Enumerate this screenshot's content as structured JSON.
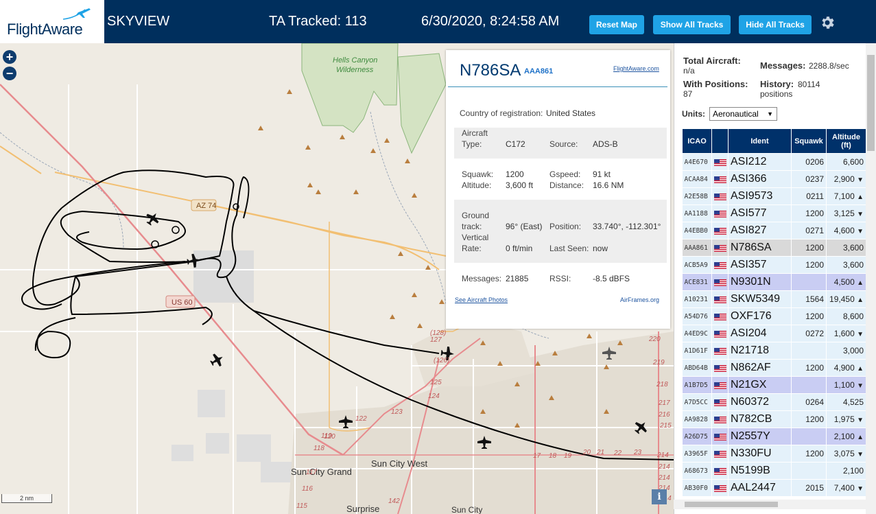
{
  "header": {
    "logo": "FlightAware",
    "site_name": "SKYVIEW",
    "tracked": "TA Tracked: 113",
    "datetime": "6/30/2020, 8:24:58 AM",
    "reset_map": "Reset Map",
    "show_all_tracks": "Show All Tracks",
    "hide_all_tracks": "Hide All Tracks",
    "settings_icon": "gear-icon"
  },
  "map": {
    "zoom_in": "+",
    "zoom_out": "−",
    "scale": "2 nm",
    "info": "i",
    "labels": {
      "wilderness1": "Hells Canyon",
      "wilderness2": "Wilderness",
      "route_az74": "AZ 74",
      "route_us60": "US 60",
      "city1": "Sun City Grand",
      "city2": "Sun City West",
      "city3": "Surprise",
      "city4": "Sun City",
      "r128": "(128)",
      "r127": "127",
      "r126": "(126)",
      "r125": "125",
      "r124": "124",
      "r123": "123",
      "r122": "122",
      "r121": "121",
      "r120": "120",
      "r119": "119",
      "r118": "118",
      "r117": "117",
      "r116": "116",
      "r115": "115",
      "r142": "142",
      "r17": "17",
      "r18": "18",
      "r19": "19",
      "r20": "20",
      "r21": "21",
      "r22": "22",
      "r23": "23",
      "r220": "220",
      "r219": "219",
      "r218": "218",
      "r217": "217",
      "r216": "216",
      "r215": "215",
      "r214a": "214",
      "r214b": "214",
      "r214c": "214",
      "r214d": "214",
      "r214e": "214"
    }
  },
  "popup": {
    "callsign": "N786SA",
    "icao": "AAA861",
    "flightaware_link": "FlightAware.com",
    "country_label": "Country of registration:",
    "country_value": "United States",
    "aircraft_type_label1": "Aircraft",
    "aircraft_type_label2": "Type:",
    "aircraft_type": "C172",
    "source_label": "Source:",
    "source": "ADS-B",
    "squawk_label": "Squawk:",
    "squawk": "1200",
    "gspeed_label": "Gspeed:",
    "gspeed": "91 kt",
    "altitude_label": "Altitude:",
    "altitude": "3,600 ft",
    "distance_label": "Distance:",
    "distance": "16.6 NM",
    "gt_label1": "Ground",
    "gt_label2": "track:",
    "ground_track": "96° (East)",
    "position_label": "Position:",
    "position": "33.740°, -112.301°",
    "vr_label1": "Vertical",
    "vr_label2": "Rate:",
    "vertical_rate": "0 ft/min",
    "last_seen_label": "Last Seen:",
    "last_seen": "now",
    "messages_label": "Messages:",
    "messages": "21885",
    "rssi_label": "RSSI:",
    "rssi": "-8.5 dBFS",
    "photos_link": "See Aircraft Photos",
    "airframes": "AirFrames.org"
  },
  "panel": {
    "total_aircraft_label": "Total Aircraft:",
    "total_aircraft": "n/a",
    "messages_label": "Messages:",
    "messages": "2288.8/sec",
    "with_positions_label": "With Positions:",
    "with_positions": "87",
    "history_label": "History:",
    "history_value": "80114",
    "history_unit": "positions",
    "units_label": "Units:",
    "units_value": "Aeronautical",
    "columns": [
      "ICAO",
      "",
      "Ident",
      "Squawk",
      "Altitude",
      "(ft)"
    ],
    "rows": [
      {
        "icao": "A4E670",
        "ident": "ASI212",
        "squawk": "0206",
        "alt": "6,600",
        "trend": "",
        "style": ""
      },
      {
        "icao": "ACAA84",
        "ident": "ASI366",
        "squawk": "0237",
        "alt": "2,900",
        "trend": "▼",
        "style": ""
      },
      {
        "icao": "A2E58B",
        "ident": "ASI9573",
        "squawk": "0211",
        "alt": "7,100",
        "trend": "▲",
        "style": ""
      },
      {
        "icao": "AA1188",
        "ident": "ASI577",
        "squawk": "1200",
        "alt": "3,125",
        "trend": "▼",
        "style": ""
      },
      {
        "icao": "A4EBB0",
        "ident": "ASI827",
        "squawk": "0271",
        "alt": "4,600",
        "trend": "▼",
        "style": ""
      },
      {
        "icao": "AAA861",
        "ident": "N786SA",
        "squawk": "1200",
        "alt": "3,600",
        "trend": "",
        "style": "sel"
      },
      {
        "icao": "ACB5A9",
        "ident": "ASI357",
        "squawk": "1200",
        "alt": "3,600",
        "trend": "",
        "style": ""
      },
      {
        "icao": "ACE831",
        "ident": "N9301N",
        "squawk": "",
        "alt": "4,500",
        "trend": "▲",
        "style": "mlat"
      },
      {
        "icao": "A10231",
        "ident": "SKW5349",
        "squawk": "1564",
        "alt": "19,450",
        "trend": "▲",
        "style": ""
      },
      {
        "icao": "A54D76",
        "ident": "OXF176",
        "squawk": "1200",
        "alt": "8,600",
        "trend": "",
        "style": ""
      },
      {
        "icao": "A4ED9C",
        "ident": "ASI204",
        "squawk": "0272",
        "alt": "1,600",
        "trend": "▼",
        "style": ""
      },
      {
        "icao": "A1D61F",
        "ident": "N21718",
        "squawk": "",
        "alt": "3,000",
        "trend": "",
        "style": ""
      },
      {
        "icao": "ABD64B",
        "ident": "N862AF",
        "squawk": "1200",
        "alt": "4,900",
        "trend": "▲",
        "style": ""
      },
      {
        "icao": "A1B7D5",
        "ident": "N21GX",
        "squawk": "",
        "alt": "1,100",
        "trend": "▼",
        "style": "mlat"
      },
      {
        "icao": "A7D5CC",
        "ident": "N60372",
        "squawk": "0264",
        "alt": "4,525",
        "trend": "",
        "style": ""
      },
      {
        "icao": "AA9828",
        "ident": "N782CB",
        "squawk": "1200",
        "alt": "1,975",
        "trend": "▼",
        "style": ""
      },
      {
        "icao": "A26D75",
        "ident": "N2557Y",
        "squawk": "",
        "alt": "2,100",
        "trend": "▲",
        "style": "mlat"
      },
      {
        "icao": "A3965F",
        "ident": "N330FU",
        "squawk": "1200",
        "alt": "3,075",
        "trend": "▼",
        "style": ""
      },
      {
        "icao": "A68673",
        "ident": "N5199B",
        "squawk": "",
        "alt": "2,100",
        "trend": "",
        "style": ""
      },
      {
        "icao": "AB30F0",
        "ident": "AAL2447",
        "squawk": "2015",
        "alt": "7,400",
        "trend": "▼",
        "style": ""
      }
    ]
  }
}
